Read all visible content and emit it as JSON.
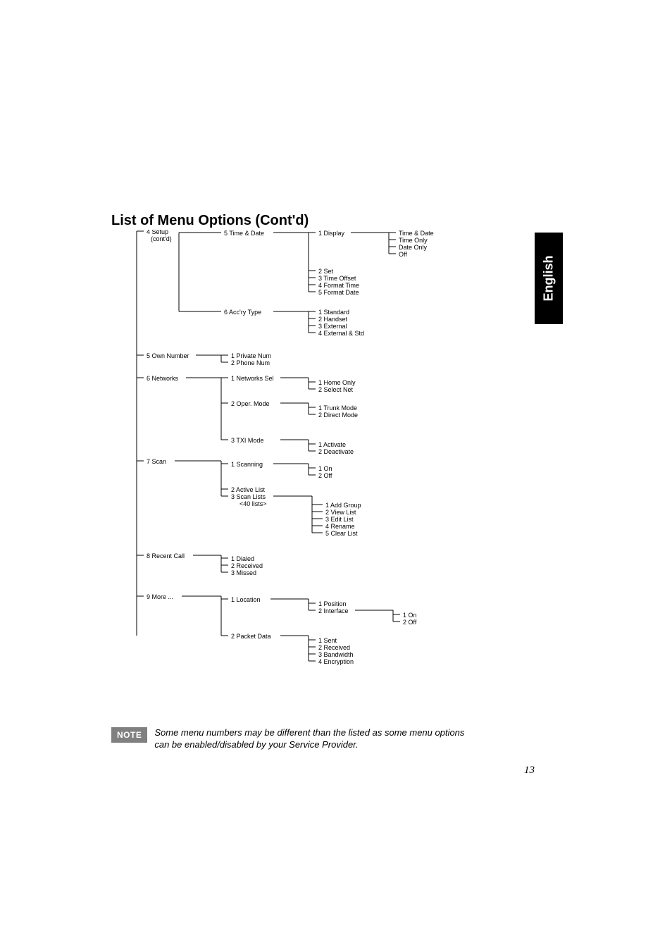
{
  "page": {
    "heading": "List of Menu Options (Cont'd)",
    "sideTab": "English",
    "noteBadge": "NOTE",
    "noteText": "Some menu numbers may be different than the listed as some menu options can be enabled/disabled by your Service Provider.",
    "pageNumber": "13"
  },
  "menu": {
    "root": "4  Setup",
    "rootSub": "(cont'd)",
    "timeDate": "5   Time & Date",
    "display": "1   Display",
    "displayOpts": [
      "Time & Date",
      "Time Only",
      "Date Only",
      "Off"
    ],
    "set": "2   Set",
    "timeOffset": "3   Time Offset",
    "formatTime": "4   Format Time",
    "formatDate": "5   Format Date",
    "accryType": "6   Acc'ry Type",
    "accryOpts": [
      "1   Standard",
      "2   Handset",
      "3   External",
      "4   External & Std"
    ],
    "ownNumber": "5   Own Number",
    "ownOpts": [
      "1   Private Num",
      "2   Phone Num"
    ],
    "networks": "6   Networks",
    "netSel": "1   Networks Sel",
    "netSelOpts": [
      "1   Home Only",
      "2   Select Net"
    ],
    "operMode": "2   Oper. Mode",
    "operOpts": [
      "1   Trunk Mode",
      "2   Direct Mode"
    ],
    "txiMode": "3   TXI Mode",
    "txiOpts": [
      "1   Activate",
      "2   Deactivate"
    ],
    "scan": "7   Scan",
    "scanning": "1   Scanning",
    "scanOnOff": [
      "1   On",
      "2   Off"
    ],
    "activeList": "2   Active List",
    "scanLists": "3   Scan Lists",
    "scanListsSub": "<40 lists>",
    "scanListsOpts": [
      "1    Add Group",
      "2    View List",
      "3    Edit List",
      "4    Rename",
      "5    Clear List"
    ],
    "recent": "8   Recent Call",
    "recentOpts": [
      "1   Dialed",
      "2   Received",
      "3   Missed"
    ],
    "more": "9   More ...",
    "location": "1   Location",
    "locOpts": [
      "1   Position",
      "2   Interface"
    ],
    "locOnOff": [
      "1   On",
      "2   Off"
    ],
    "packet": "2   Packet Data",
    "packetOpts": [
      "1   Sent",
      "2   Received",
      "3   Bandwidth",
      "4   Encryption"
    ]
  }
}
